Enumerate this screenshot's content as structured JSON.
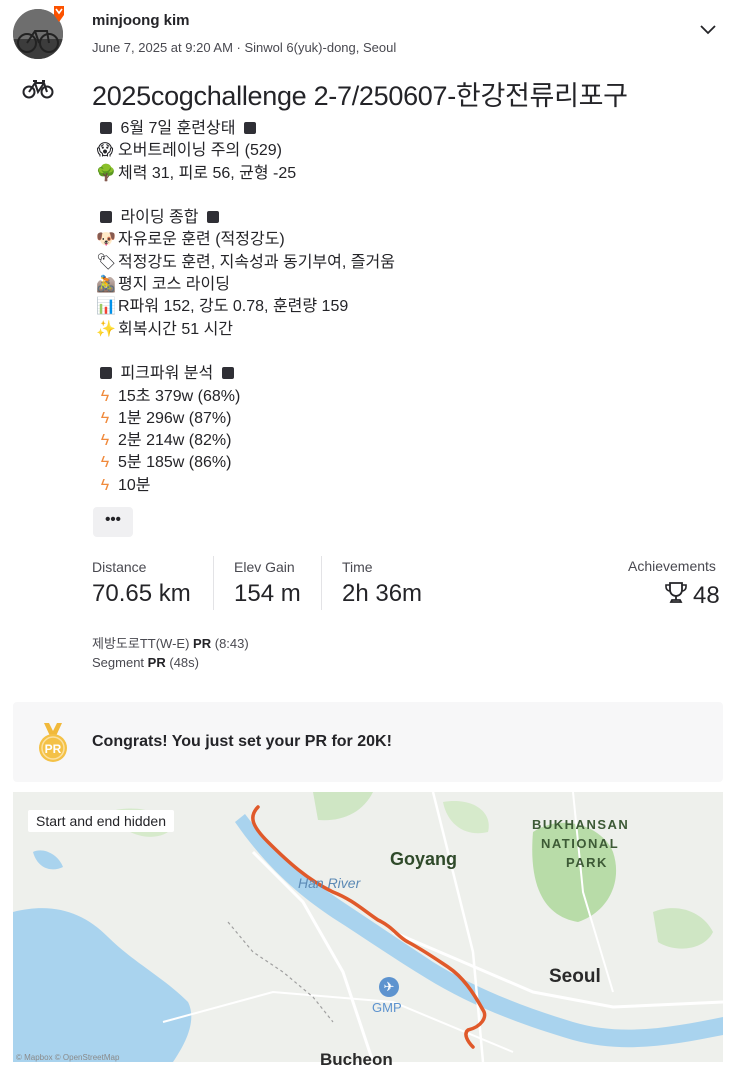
{
  "header": {
    "athlete_name": "minjoong kim",
    "meta": "June 7, 2025 at 9:20 AM · Sinwol 6(yuk)-dong, Seoul"
  },
  "activity": {
    "title": "2025cogchallenge 2-7/250607-한강전류리포구",
    "more_label": "•••",
    "description": {
      "status_header": "6월 7일 훈련상태",
      "overtraining": "오버트레이닝 주의 (529)",
      "fitness": "체력 31, 피로 56, 균형 -25",
      "summary_header": "라이딩 종합",
      "free_training": "자유로운 훈련 (적정강도)",
      "training_note": "적정강도 훈련, 지속성과 동기부여, 즐거움",
      "course": "평지 코스 라이딩",
      "power": "R파워 152, 강도 0.78, 훈련량 159",
      "recovery": "회복시간 51 시간",
      "peak_header": "피크파워 분석",
      "peaks": [
        "15초 379w (68%)",
        "1분 296w (87%)",
        "2분 214w (82%)",
        "5분 185w (86%)",
        "10분"
      ]
    }
  },
  "stats": {
    "distance": {
      "label": "Distance",
      "value": "70.65 km"
    },
    "elev": {
      "label": "Elev Gain",
      "value": "154 m"
    },
    "time": {
      "label": "Time",
      "value": "2h 36m"
    },
    "achievements": {
      "label": "Achievements",
      "value": "48"
    }
  },
  "segments": {
    "seg1_name": "제방도로TT(W-E)",
    "seg1_pr": "PR",
    "seg1_time": "(8:43)",
    "seg2_name": "Segment",
    "seg2_pr": "PR",
    "seg2_time": "(48s)"
  },
  "pr_card": {
    "badge": "PR",
    "text": "Congrats! You just set your PR for 20K!"
  },
  "map": {
    "hidden_label": "Start and end hidden",
    "places": {
      "goyang": "Goyang",
      "han_river": "Han River",
      "bukhansan": "BUKHANSAN",
      "national": "NATIONAL",
      "park": "PARK",
      "seoul": "Seoul",
      "gmp": "GMP",
      "bucheon": "Bucheon"
    },
    "attribution": "© Mapbox © OpenStreetMap",
    "route_color": "#e0592a"
  },
  "colors": {
    "text": "#242428",
    "muted": "#494950",
    "accent": "#fc5200"
  }
}
